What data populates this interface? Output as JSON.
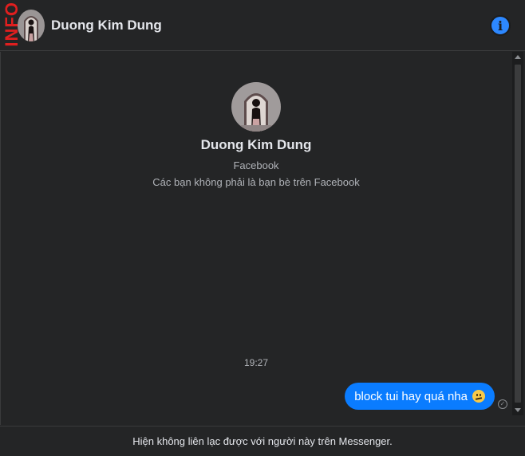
{
  "side_tag": "INFO",
  "header": {
    "name": "Duong Kim Dung",
    "info_icon": "info-icon"
  },
  "profile": {
    "name": "Duong Kim Dung",
    "source": "Facebook",
    "relation": "Các bạn không phải là bạn bè trên Facebook"
  },
  "messages": [
    {
      "time": "19:27",
      "text": "block tui hay quá nha",
      "emoji": "confused-face-emoji",
      "status_icon": "sent-check-icon"
    }
  ],
  "footer": {
    "notice": "Hiện không liên lạc được với người này trên Messenger."
  },
  "colors": {
    "background": "#242526",
    "bubble": "#0a7cff",
    "info_button": "#2d88ff",
    "tag": "#e01f1f"
  }
}
